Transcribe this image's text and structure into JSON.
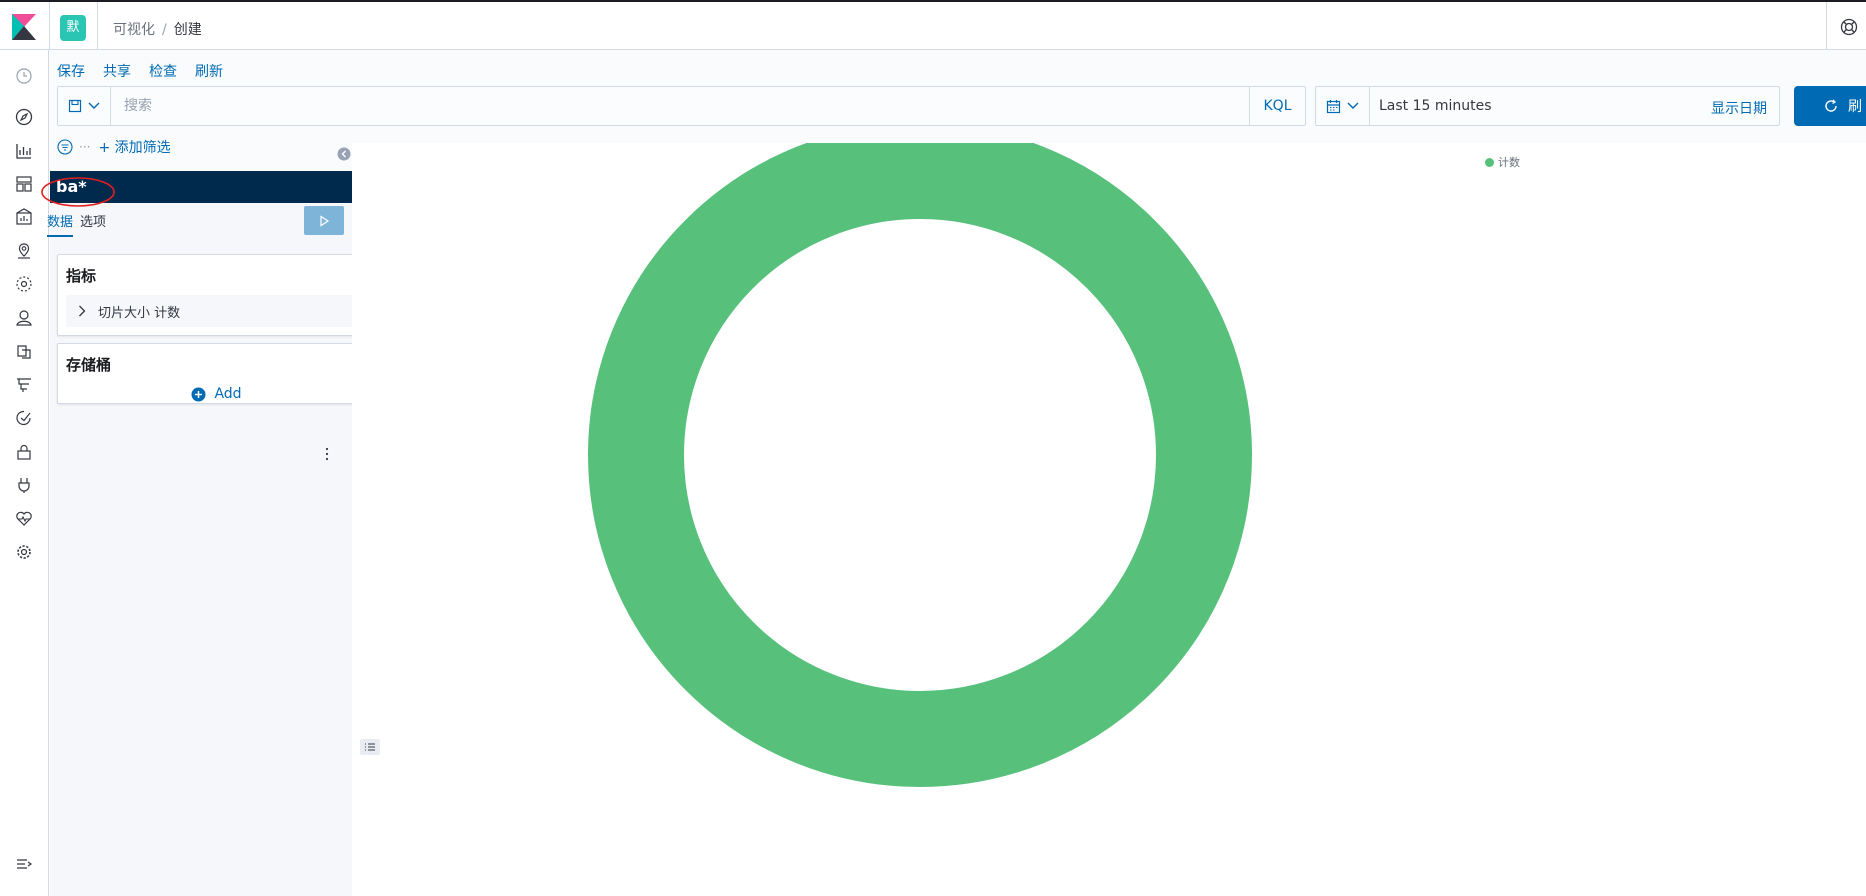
{
  "header": {
    "space_initial": "默",
    "breadcrumbs": [
      "可视化",
      "创建"
    ]
  },
  "topmenu": {
    "save": "保存",
    "share": "共享",
    "inspect": "检查",
    "refresh": "刷新"
  },
  "query": {
    "placeholder": "搜索",
    "language": "KQL"
  },
  "time": {
    "range": "Last 15 minutes",
    "show_dates": "显示日期",
    "refresh_label": "刷"
  },
  "filter": {
    "add_filter": "+ 添加筛选"
  },
  "sidebar": {
    "index_pattern": "ba*",
    "tabs": [
      "数据",
      "选项"
    ],
    "metrics_title": "指标",
    "metric_item": "切片大小 计数",
    "buckets_title": "存储桶",
    "add_label": "Add"
  },
  "chart_data": {
    "type": "pie",
    "donut": true,
    "categories": [
      "计数"
    ],
    "values": [
      1
    ],
    "colors": [
      "#57c17b"
    ],
    "legend": [
      "计数"
    ],
    "legend_placement": "top-right"
  },
  "colors": {
    "accent": "#006bb4",
    "slice": "#57c17b",
    "header_dark": "#002a4d"
  }
}
